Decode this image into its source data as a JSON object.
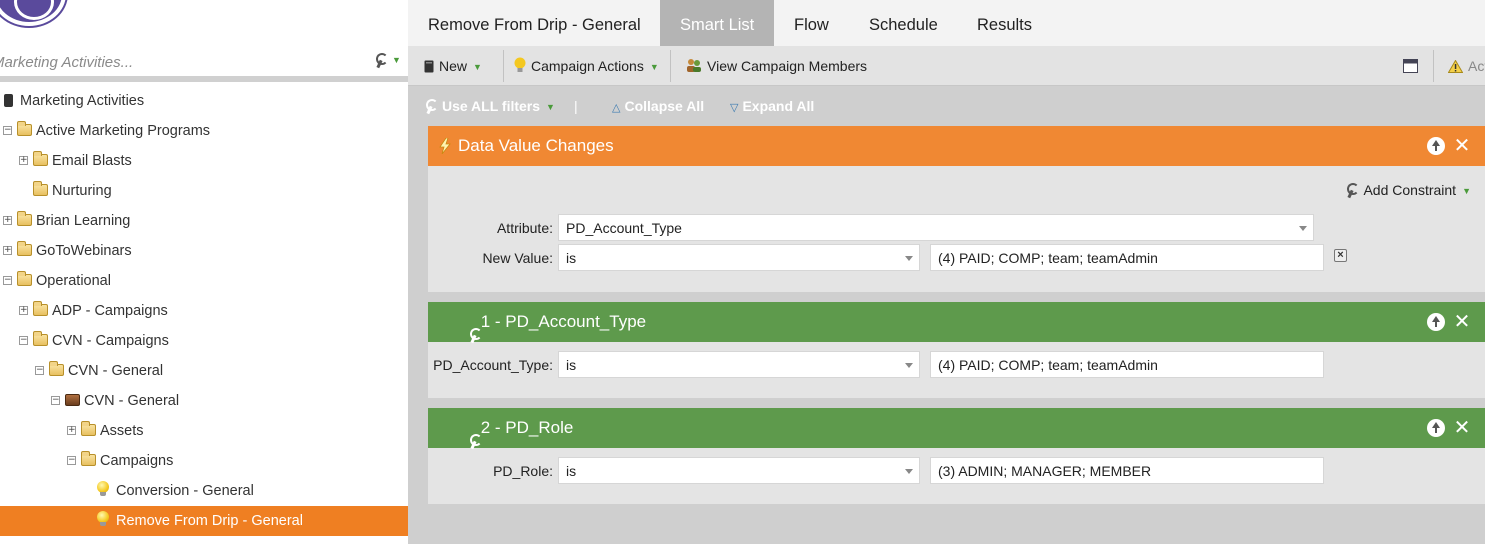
{
  "sidebar": {
    "search_placeholder": "Marketing Activities...",
    "tree": [
      {
        "label": "Marketing Activities",
        "icon": "database-icon",
        "toggle": ""
      },
      {
        "label": "Active Marketing Programs",
        "icon": "folder-icon",
        "toggle": "−"
      },
      {
        "label": "Email Blasts",
        "icon": "folder-icon",
        "toggle": "+"
      },
      {
        "label": "Nurturing",
        "icon": "folder-icon",
        "toggle": ""
      },
      {
        "label": "Brian Learning",
        "icon": "folder-icon",
        "toggle": "+"
      },
      {
        "label": "GoToWebinars",
        "icon": "folder-icon",
        "toggle": "+"
      },
      {
        "label": "Operational",
        "icon": "folder-icon",
        "toggle": "−"
      },
      {
        "label": "ADP - Campaigns",
        "icon": "folder-icon",
        "toggle": "+"
      },
      {
        "label": "CVN - Campaigns",
        "icon": "folder-icon",
        "toggle": "−"
      },
      {
        "label": "CVN - General",
        "icon": "folder-icon",
        "toggle": "−"
      },
      {
        "label": "CVN - General",
        "icon": "program-icon",
        "toggle": "−"
      },
      {
        "label": "Assets",
        "icon": "folder-icon",
        "toggle": "+"
      },
      {
        "label": "Campaigns",
        "icon": "folder-icon",
        "toggle": "−"
      },
      {
        "label": "Conversion - General",
        "icon": "lightbulb-icon",
        "toggle": ""
      },
      {
        "label": "Remove From Drip - General",
        "icon": "lightbulb-icon",
        "toggle": "",
        "selected": true
      }
    ]
  },
  "tabs": [
    {
      "label": "Remove From Drip - General"
    },
    {
      "label": "Smart List",
      "active": true
    },
    {
      "label": "Flow"
    },
    {
      "label": "Schedule"
    },
    {
      "label": "Results"
    }
  ],
  "toolbar": {
    "new_label": "New",
    "campaign_actions_label": "Campaign Actions",
    "view_members_label": "View Campaign Members",
    "activity_label": "Act"
  },
  "filterbar": {
    "use_label": "Use ALL filters",
    "separator": "|",
    "collapse_label": "Collapse All",
    "expand_label": "Expand All"
  },
  "triggers": [
    {
      "title": "Data Value Changes",
      "add_constraint_label": "Add Constraint",
      "attribute_label": "Attribute:",
      "attribute_value": "PD_Account_Type",
      "new_value_label": "New Value:",
      "operator": "is",
      "value": "(4) PAID; COMP; team; teamAdmin"
    }
  ],
  "filters": [
    {
      "title": "1 - PD_Account_Type",
      "field_label": "PD_Account_Type:",
      "operator": "is",
      "value": "(4) PAID; COMP; team; teamAdmin"
    },
    {
      "title": "2 - PD_Role",
      "field_label": "PD_Role:",
      "operator": "is",
      "value": "(3) ADMIN; MANAGER; MEMBER"
    }
  ],
  "colors": {
    "accent_orange": "#ef7f22",
    "filter_green": "#5e9a4c",
    "trigger_orange": "#f08833"
  }
}
